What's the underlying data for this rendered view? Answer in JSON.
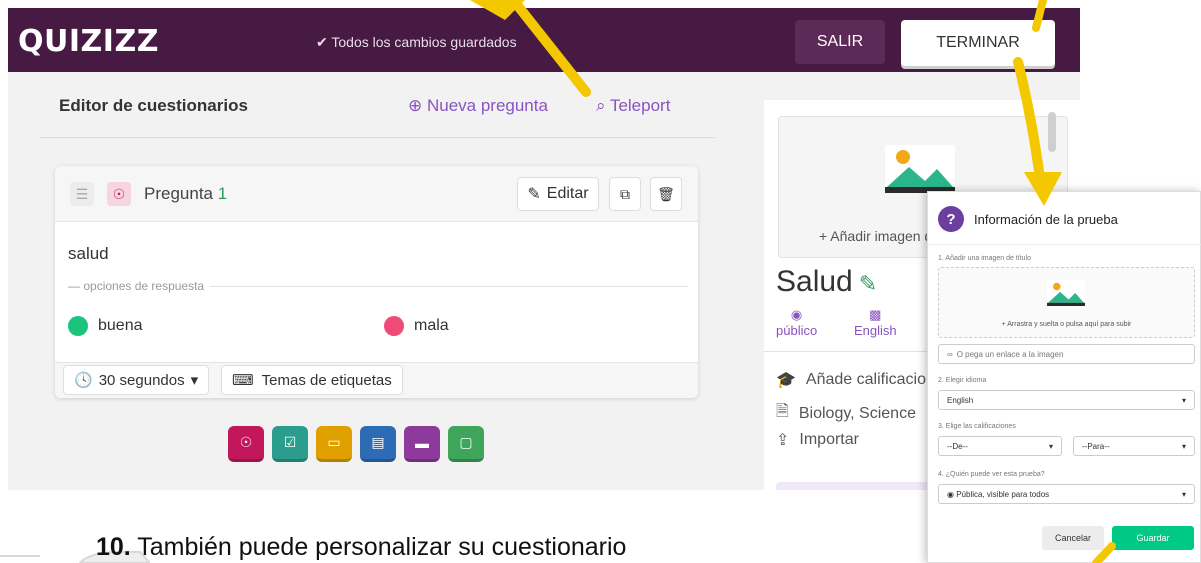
{
  "header": {
    "logo": "QUIZIZZ",
    "save_status": "✔ Todos los cambios guardados",
    "exit_label": "SALIR",
    "finish_label": "TERMINAR"
  },
  "editor": {
    "title": "Editor de cuestionarios",
    "new_question": "⊕ Nueva pregunta",
    "teleport": "Teleport"
  },
  "question": {
    "label": "Pregunta",
    "number": "1",
    "edit_label": "Editar",
    "text": "salud",
    "options_label": "opciones de respuesta",
    "options": [
      {
        "text": "buena",
        "color": "#1bc47d"
      },
      {
        "text": "mala",
        "color": "#ee4c76"
      }
    ],
    "time": "30 segundos",
    "tags": "Temas de etiquetas"
  },
  "question_types": [
    {
      "icon": "radio-icon",
      "color": "#c2185b"
    },
    {
      "icon": "checkbox-icon",
      "color": "#2a9d8f"
    },
    {
      "icon": "fill-blank-icon",
      "color": "#e0a100"
    },
    {
      "icon": "poll-icon",
      "color": "#2d6cb5"
    },
    {
      "icon": "open-ended-icon",
      "color": "#8e3a9d"
    },
    {
      "icon": "slide-icon",
      "color": "#3ea55a"
    }
  ],
  "sidebar": {
    "add_image": "+ Añadir imagen del",
    "quiz_title": "Salud",
    "visibility_label": "público",
    "language_label": "English",
    "grades": "Añade calificacion",
    "subjects": "Biology, Science",
    "import": "Importar"
  },
  "dialog": {
    "title": "Información de la prueba",
    "step1": "1. Añadir una imagen de título",
    "upload_text": "+ Arrastra y suelta o pulsa aquí para subir",
    "link_placeholder": "O pega un enlace a la imagen",
    "step2": "2. Elegir idioma",
    "language": "English",
    "step3": "3. Elige las calificaciones",
    "grade_from": "--De--",
    "grade_to": "--Para--",
    "step4": "4. ¿Quién puede ver esta prueba?",
    "visibility": "Pública, visible para todos",
    "cancel": "Cancelar",
    "save": "Guardar"
  },
  "caption": {
    "number": "10.",
    "text": " También puede personalizar su cuestionario"
  },
  "colors": {
    "brand_purple": "#461a42",
    "accent_purple": "#8854c0",
    "arrow_yellow": "#f3c800",
    "save_green": "#00c985"
  }
}
